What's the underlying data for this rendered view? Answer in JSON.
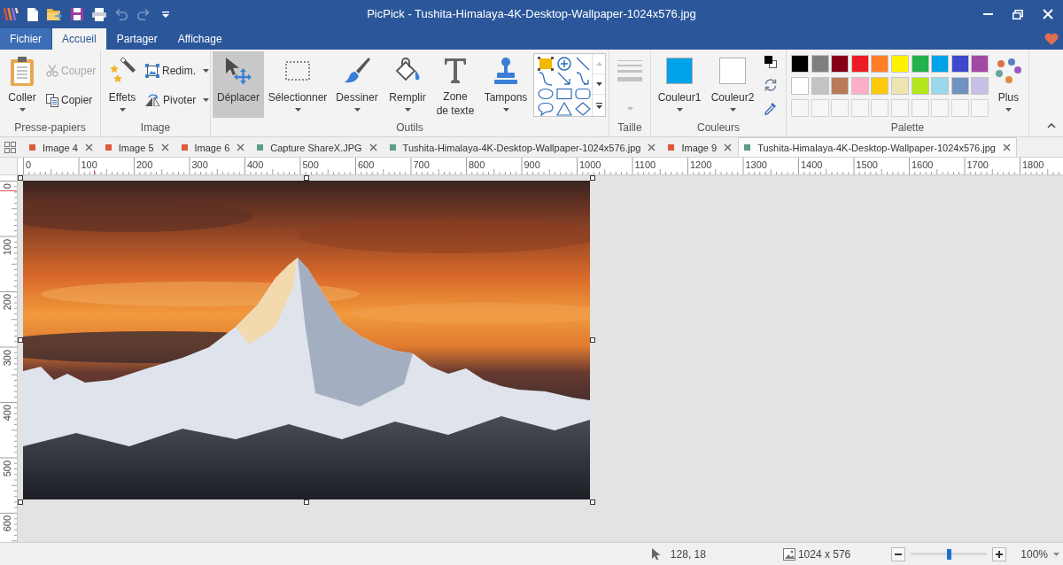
{
  "window": {
    "title": "PicPick - Tushita-Himalaya-4K-Desktop-Wallpaper-1024x576.jpg"
  },
  "quick_access": [
    {
      "kind": "new",
      "disabled": false
    },
    {
      "kind": "open",
      "disabled": false
    },
    {
      "kind": "save",
      "disabled": false
    },
    {
      "kind": "print",
      "disabled": false
    },
    {
      "kind": "undo",
      "disabled": true
    },
    {
      "kind": "redo",
      "disabled": true
    },
    {
      "kind": "customize",
      "disabled": false
    }
  ],
  "ribbon_tabs": [
    {
      "label": "Fichier",
      "kind": "file",
      "selected": false
    },
    {
      "label": "Accueil",
      "kind": "tab",
      "selected": true
    },
    {
      "label": "Partager",
      "kind": "tab",
      "selected": false
    },
    {
      "label": "Affichage",
      "kind": "tab",
      "selected": false
    }
  ],
  "clipboard": {
    "label": "Presse-papiers",
    "paste": {
      "label": "Coller"
    },
    "cut": {
      "label": "Couper",
      "disabled": true
    },
    "copy": {
      "label": "Copier",
      "disabled": false
    }
  },
  "image": {
    "label": "Image",
    "effects": {
      "label": "Effets"
    },
    "resize": {
      "label": "Redim."
    },
    "rotate": {
      "label": "Pivoter"
    }
  },
  "tools": {
    "label": "Outils",
    "items": [
      {
        "kind": "move",
        "label": "Déplacer",
        "selected": true,
        "dropdown": false
      },
      {
        "kind": "select",
        "label": "Sélectionner",
        "selected": false,
        "dropdown": true
      },
      {
        "kind": "draw",
        "label": "Dessiner",
        "selected": false,
        "dropdown": true
      },
      {
        "kind": "fill",
        "label": "Remplir",
        "selected": false,
        "dropdown": true
      },
      {
        "kind": "text",
        "label": "Zone de texte",
        "selected": false,
        "dropdown": false
      },
      {
        "kind": "stamp",
        "label": "Tampons",
        "selected": false,
        "dropdown": true
      }
    ]
  },
  "size": {
    "label": "Taille",
    "disabled": true
  },
  "colors": {
    "label": "Couleurs",
    "primary": {
      "label": "Couleur1",
      "color": "#00a2e8"
    },
    "secondary": {
      "label": "Couleur2",
      "color": "#ffffff"
    }
  },
  "palette": {
    "label": "Palette",
    "swatches": [
      {
        "kind": "color",
        "color": "#000000"
      },
      {
        "kind": "color",
        "color": "#7f7f7f"
      },
      {
        "kind": "color",
        "color": "#880015"
      },
      {
        "kind": "color",
        "color": "#ed1c24"
      },
      {
        "kind": "color",
        "color": "#ff7f27"
      },
      {
        "kind": "color",
        "color": "#fff200"
      },
      {
        "kind": "color",
        "color": "#22b14c"
      },
      {
        "kind": "color",
        "color": "#00a2e8"
      },
      {
        "kind": "color",
        "color": "#3f48cc"
      },
      {
        "kind": "color",
        "color": "#a349a4"
      },
      {
        "kind": "color",
        "color": "#ffffff"
      },
      {
        "kind": "color",
        "color": "#c3c3c3"
      },
      {
        "kind": "color",
        "color": "#b97a57"
      },
      {
        "kind": "color",
        "color": "#ffaec9"
      },
      {
        "kind": "color",
        "color": "#ffc90e"
      },
      {
        "kind": "color",
        "color": "#efe4b0"
      },
      {
        "kind": "color",
        "color": "#b5e61d"
      },
      {
        "kind": "color",
        "color": "#99d9ea"
      },
      {
        "kind": "color",
        "color": "#7092be"
      },
      {
        "kind": "color",
        "color": "#c8bfe7"
      },
      {
        "kind": "empty"
      },
      {
        "kind": "empty"
      },
      {
        "kind": "empty"
      },
      {
        "kind": "empty"
      },
      {
        "kind": "empty"
      },
      {
        "kind": "empty"
      },
      {
        "kind": "empty"
      },
      {
        "kind": "empty"
      },
      {
        "kind": "empty"
      },
      {
        "kind": "empty"
      }
    ],
    "more": {
      "label": "Plus"
    }
  },
  "document_tabs": [
    {
      "label": "Image 4",
      "color": "#e0583c",
      "selected": false
    },
    {
      "label": "Image 5",
      "color": "#e0583c",
      "selected": false
    },
    {
      "label": "Image 6",
      "color": "#e0583c",
      "selected": false
    },
    {
      "label": "Capture ShareX.JPG",
      "color": "#5c9e87",
      "selected": false
    },
    {
      "label": "Tushita-Himalaya-4K-Desktop-Wallpaper-1024x576.jpg",
      "color": "#5c9e87",
      "selected": false
    },
    {
      "label": "Image 9",
      "color": "#e0583c",
      "selected": false
    },
    {
      "label": "Tushita-Himalaya-4K-Desktop-Wallpaper-1024x576.jpg",
      "color": "#5c9e87",
      "selected": true
    }
  ],
  "ruler": {
    "x_labels": [
      "0",
      "100",
      "200",
      "300",
      "400",
      "500",
      "600",
      "700",
      "800",
      "900",
      "1000",
      "1100",
      "1200",
      "1300",
      "1400",
      "1500",
      "1600",
      "1700",
      "1800"
    ],
    "y_labels": [
      "0",
      "100",
      "200",
      "300",
      "400",
      "500",
      "600"
    ]
  },
  "status_bar": {
    "cursor_position": "128, 18",
    "image_size": "1024 x 576",
    "zoom": {
      "level": 0.5
    },
    "zoom_percent": "100%"
  }
}
